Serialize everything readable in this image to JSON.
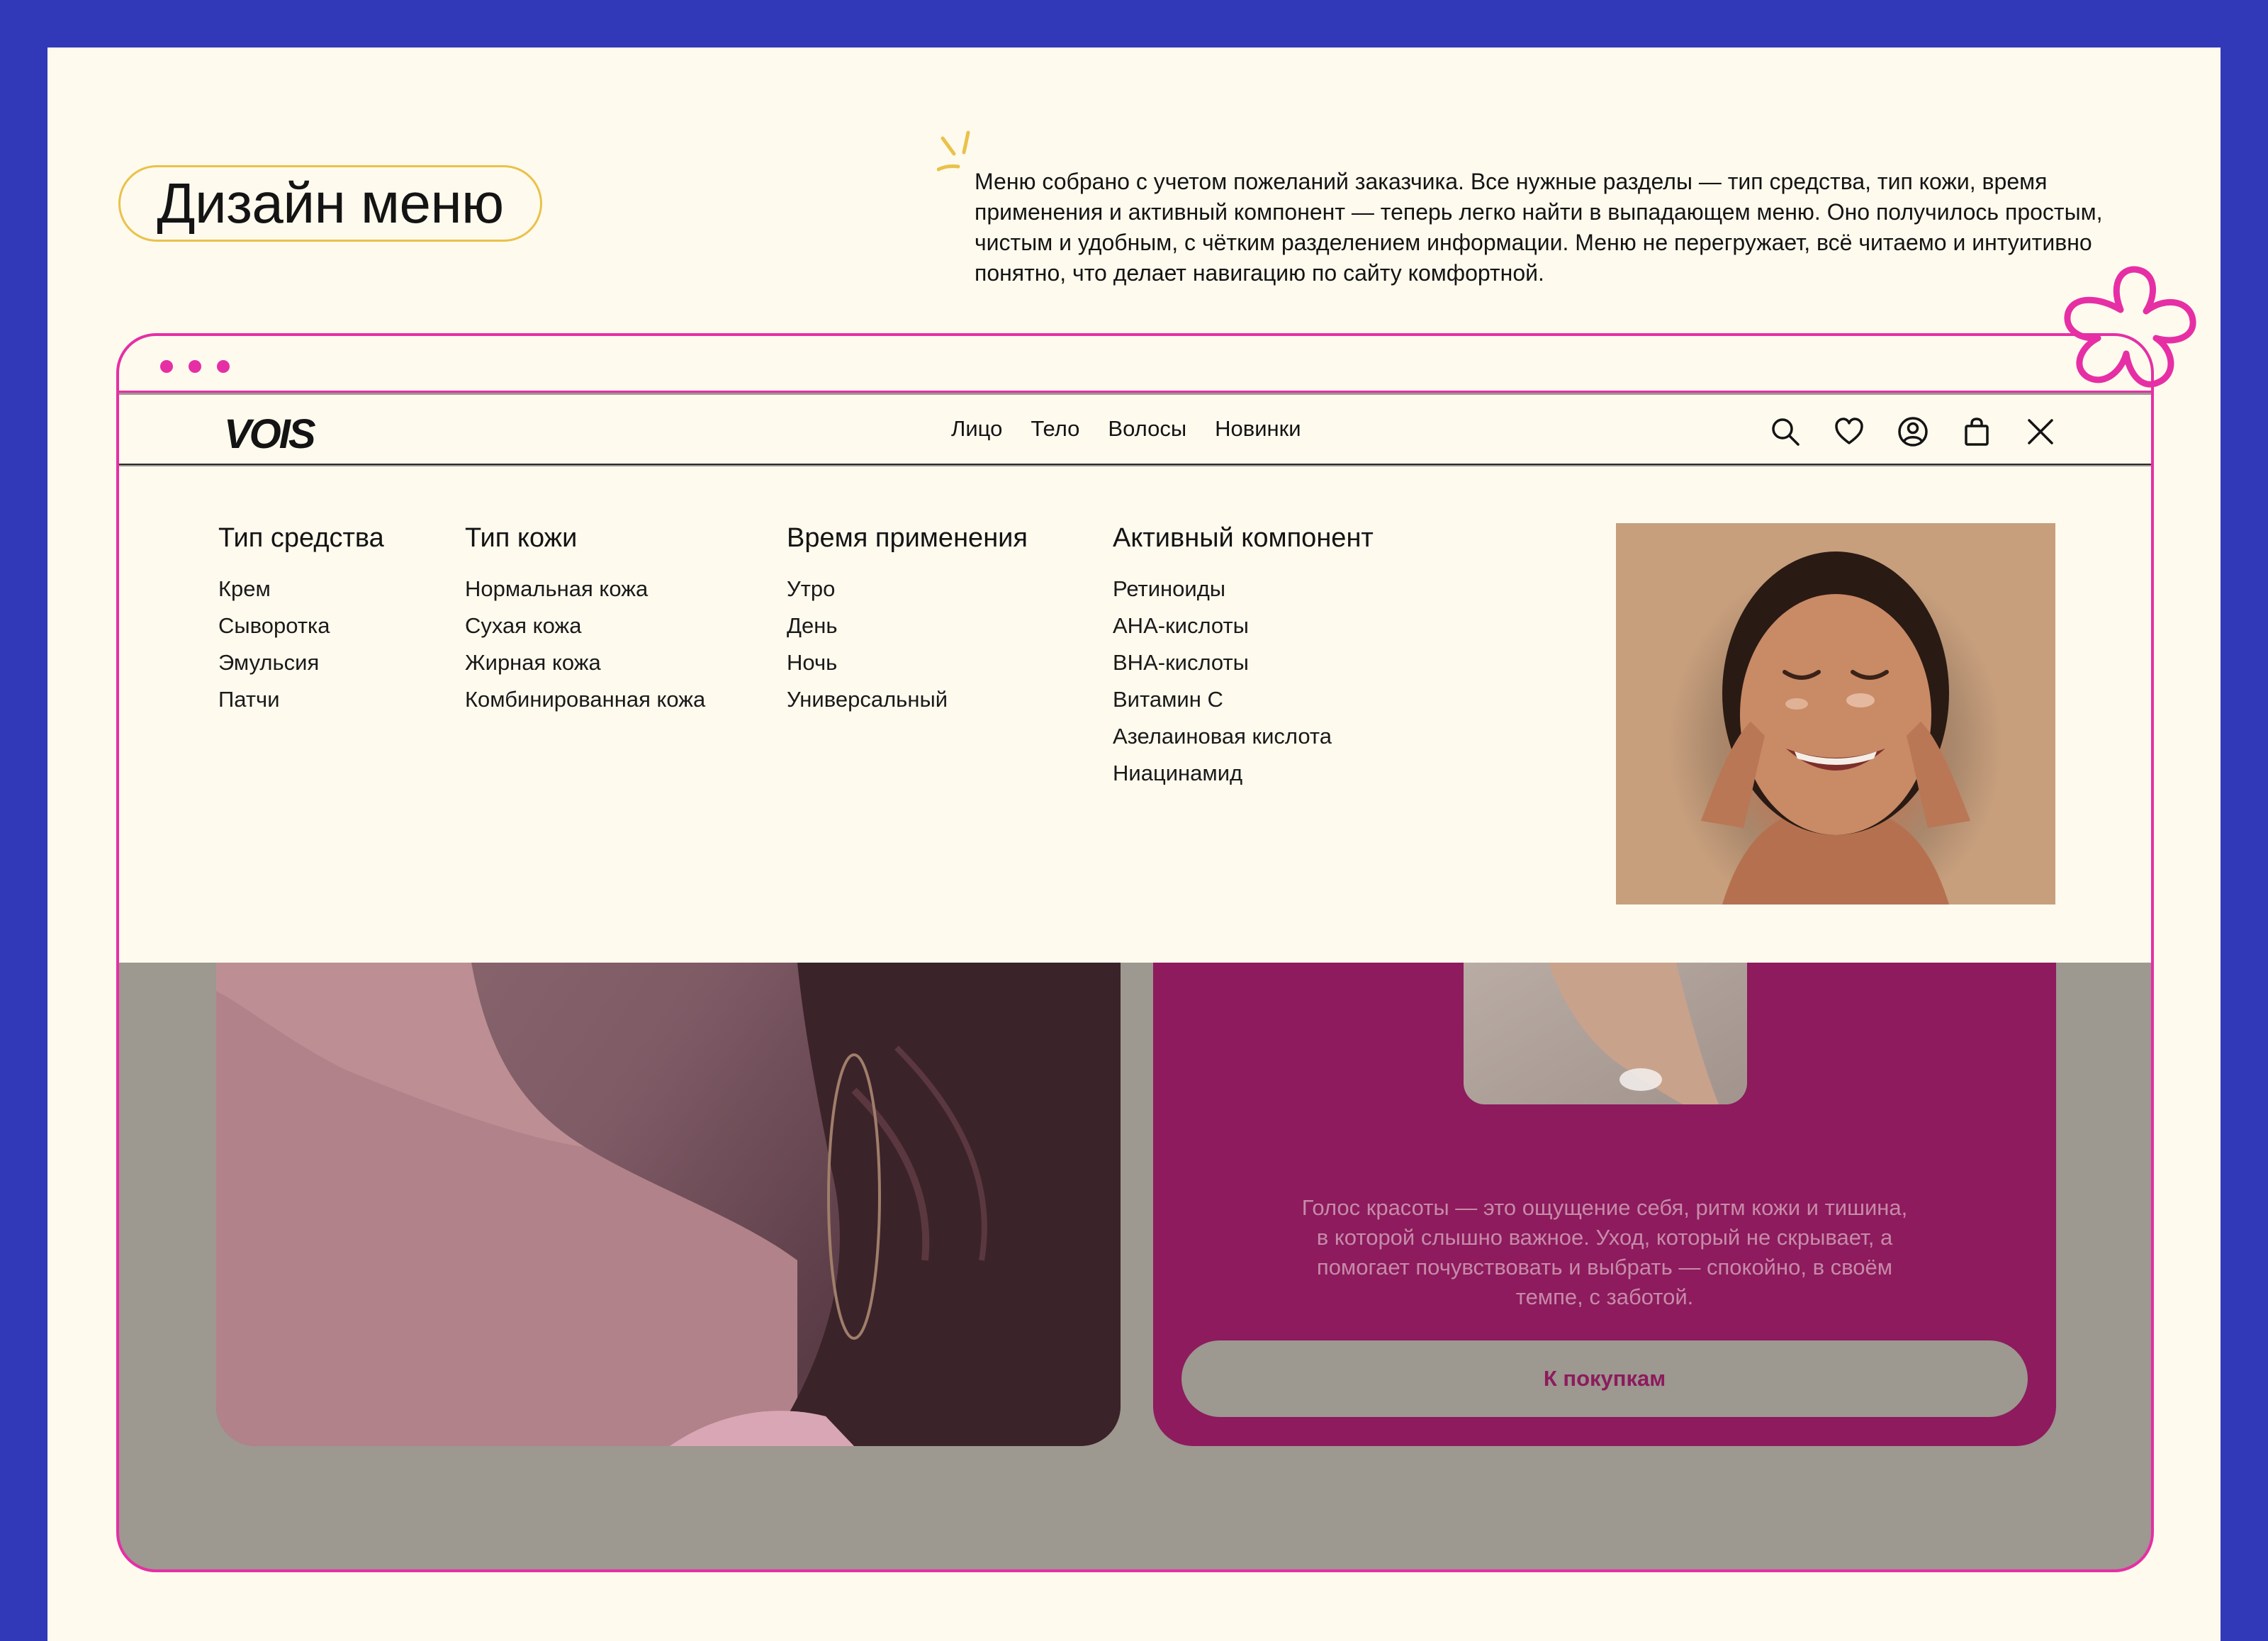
{
  "page": {
    "title": "Дизайн меню",
    "description": "Меню собрано с учетом пожеланий заказчика. Все нужные разделы — тип средства, тип кожи, время применения и активный компонент — теперь легко найти в выпадающем меню. Оно получилось простым, чистым и удобным, с чётким разделением информации. Меню не перегружает, всё читаемо и интуитивно понятно, что делает навигацию по сайту комфортной."
  },
  "colors": {
    "frame": "#3239b8",
    "board": "#fffaee",
    "accent_pink": "#e62fa5",
    "accent_yellow": "#e9c24a",
    "magenta": "#8d1b5d",
    "overlay": "#9d9890"
  },
  "site": {
    "logo": "VOIS",
    "nav": [
      "Лицо",
      "Тело",
      "Волосы",
      "Новинки"
    ],
    "icons": [
      "search-icon",
      "heart-icon",
      "user-icon",
      "shopping-bag-icon",
      "close-icon"
    ]
  },
  "menu": {
    "product_type": {
      "title": "Тип средства",
      "items": [
        "Крем",
        "Сыворотка",
        "Эмульсия",
        "Патчи"
      ]
    },
    "skin_type": {
      "title": "Тип кожи",
      "items": [
        "Нормальная кожа",
        "Сухая кожа",
        "Жирная кожа",
        "Комбинированная кожа"
      ]
    },
    "time": {
      "title": "Время применения",
      "items": [
        "Утро",
        "День",
        "Ночь",
        "Универсальный"
      ]
    },
    "active": {
      "title": "Активный компонент",
      "items": [
        "Ретиноиды",
        "AHA-кислоты",
        "BHA-кислоты",
        "Витамин С",
        "Азелаиновая кислота",
        "Ниацинамид"
      ]
    }
  },
  "promo": {
    "text": "Голос красоты — это ощущение себя, ритм кожи и тишина, в которой слышно важное. Уход, который не скрывает, а помогает почувствовать и выбрать — спокойно, в своём темпе, с заботой.",
    "cta": "К покупкам"
  }
}
